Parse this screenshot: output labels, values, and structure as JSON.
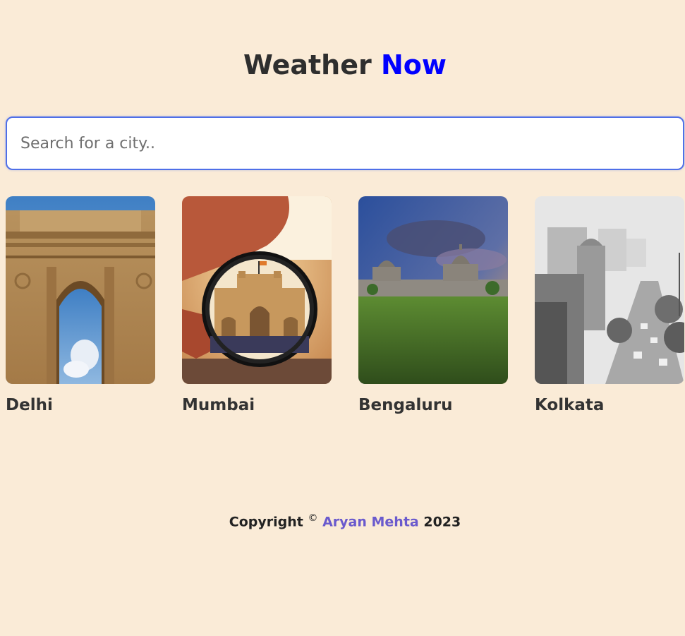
{
  "header": {
    "title_main": "Weather",
    "title_accent": "Now",
    "accent_color": "#0000ff"
  },
  "search": {
    "placeholder": "Search for a city..",
    "value": ""
  },
  "cities": [
    {
      "name": "Delhi",
      "image": "india-gate-photo"
    },
    {
      "name": "Mumbai",
      "image": "gateway-of-india-photo"
    },
    {
      "name": "Bengaluru",
      "image": "vidhana-soudha-photo"
    },
    {
      "name": "Kolkata",
      "image": "kolkata-street-photo"
    }
  ],
  "footer": {
    "prefix": "Copyright",
    "symbol": "©",
    "author": "Aryan Mehta",
    "year": "2023",
    "author_color": "#6a5acd"
  },
  "colors": {
    "background": "#faebd7",
    "search_border": "#4f6fe8"
  }
}
